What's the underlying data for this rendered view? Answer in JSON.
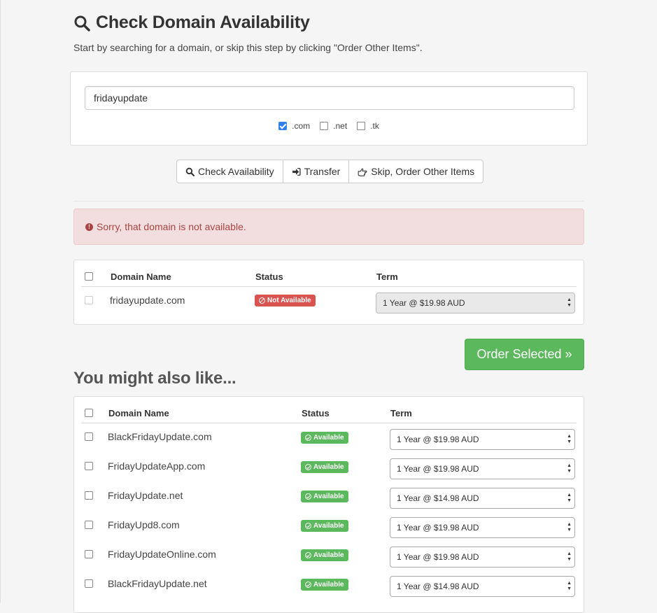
{
  "header": {
    "title": "Check Domain Availability",
    "subtitle": "Start by searching for a domain, or skip this step by clicking \"Order Other Items\"."
  },
  "search": {
    "value": "fridayupdate",
    "tlds": [
      {
        "label": ".com",
        "checked": true
      },
      {
        "label": ".net",
        "checked": false
      },
      {
        "label": ".tk",
        "checked": false
      }
    ]
  },
  "actions": {
    "check": "Check Availability",
    "transfer": "Transfer",
    "skip": "Skip, Order Other Items"
  },
  "alert": {
    "message": "Sorry, that domain is not available."
  },
  "results_table": {
    "headers": {
      "domain": "Domain Name",
      "status": "Status",
      "term": "Term"
    },
    "rows": [
      {
        "domain": "fridayupdate.com",
        "status": "Not Available",
        "term": "1 Year @ $19.98 AUD"
      }
    ]
  },
  "order_button": "Order Selected »",
  "suggestions": {
    "title": "You might also like...",
    "headers": {
      "domain": "Domain Name",
      "status": "Status",
      "term": "Term"
    },
    "rows": [
      {
        "domain": "BlackFridayUpdate.com",
        "status": "Available",
        "term": "1 Year @ $19.98 AUD"
      },
      {
        "domain": "FridayUpdateApp.com",
        "status": "Available",
        "term": "1 Year @ $19.98 AUD"
      },
      {
        "domain": "FridayUpdate.net",
        "status": "Available",
        "term": "1 Year @ $14.98 AUD"
      },
      {
        "domain": "FridayUpd8.com",
        "status": "Available",
        "term": "1 Year @ $19.98 AUD"
      },
      {
        "domain": "FridayUpdateOnline.com",
        "status": "Available",
        "term": "1 Year @ $19.98 AUD"
      },
      {
        "domain": "BlackFridayUpdate.net",
        "status": "Available",
        "term": "1 Year @ $14.98 AUD"
      }
    ]
  },
  "colors": {
    "success": "#5cb85c",
    "danger": "#d9534f",
    "alert_bg": "#f2dede",
    "alert_text": "#a94442"
  }
}
